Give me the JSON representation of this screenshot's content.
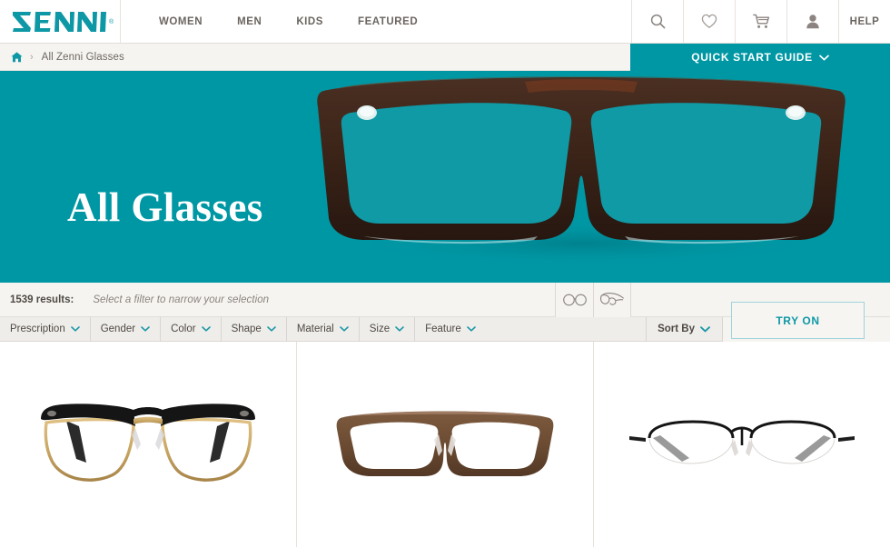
{
  "header": {
    "logo_text": "ZENNI",
    "logo_trademark": "®",
    "nav": [
      {
        "label": "WOMEN",
        "name": "nav-women"
      },
      {
        "label": "MEN",
        "name": "nav-men"
      },
      {
        "label": "KIDS",
        "name": "nav-kids"
      },
      {
        "label": "FEATURED",
        "name": "nav-featured"
      }
    ],
    "icons": [
      {
        "name": "search-icon",
        "label": "Search"
      },
      {
        "name": "heart-icon",
        "label": "Favorites"
      },
      {
        "name": "cart-icon",
        "label": "Cart"
      },
      {
        "name": "account-icon",
        "label": "Account"
      }
    ],
    "help_label": "HELP"
  },
  "breadcrumb": {
    "home_icon": "home-icon",
    "separator": "›",
    "current": "All Zenni Glasses"
  },
  "quick_start": {
    "label": "QUICK START GUIDE",
    "chevron": "chevron-down-icon"
  },
  "hero": {
    "title": "All Glasses",
    "background_color": "#0097a4",
    "image_alt": "dark brown eyeglasses on teal background"
  },
  "results": {
    "count_label": "1539 results:",
    "hint": "Select a filter to narrow your selection",
    "view_modes": [
      {
        "name": "view-front-icon",
        "label": "Front view"
      },
      {
        "name": "view-angle-icon",
        "label": "Angle view"
      }
    ]
  },
  "filters": [
    {
      "label": "Prescription",
      "name": "filter-prescription"
    },
    {
      "label": "Gender",
      "name": "filter-gender"
    },
    {
      "label": "Color",
      "name": "filter-color"
    },
    {
      "label": "Shape",
      "name": "filter-shape"
    },
    {
      "label": "Material",
      "name": "filter-material"
    },
    {
      "label": "Size",
      "name": "filter-size"
    },
    {
      "label": "Feature",
      "name": "filter-feature"
    }
  ],
  "sort": {
    "label": "Sort By",
    "chevron": "chevron-down-icon"
  },
  "try_on": {
    "label": "TRY ON",
    "border_color": "#9fd4dd",
    "text_color": "#0e98a6"
  },
  "products": [
    {
      "name": "product-1",
      "alt": "black and gold browline eyeglasses"
    },
    {
      "name": "product-2",
      "alt": "brown rectangle eyeglasses with pink temples"
    },
    {
      "name": "product-3",
      "alt": "black semi-rimless oval metal eyeglasses"
    }
  ],
  "colors": {
    "brand_teal": "#0097a4",
    "logo_teal": "#0e98a6",
    "bar_gray": "#f5f4f1",
    "filter_gray": "#efedea",
    "text_dark": "#4e4944"
  }
}
